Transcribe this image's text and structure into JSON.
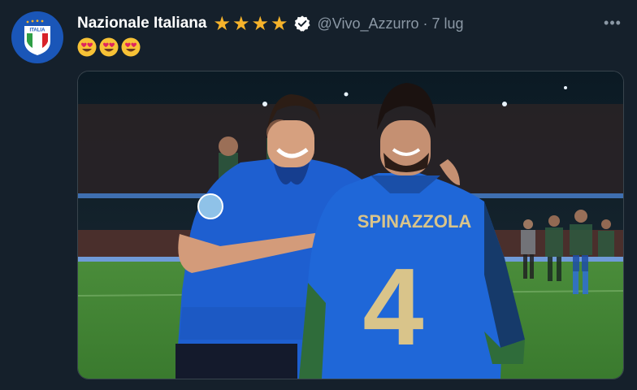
{
  "tweet": {
    "display_name": "Nazionale Italiana",
    "stars": [
      "★",
      "★",
      "★",
      "★"
    ],
    "handle": "@Vivo_Azzurro",
    "separator": "·",
    "time": "7 lug",
    "more_label": "•••",
    "text_emojis": [
      "heart-eyes-emoji",
      "heart-eyes-emoji",
      "heart-eyes-emoji"
    ]
  },
  "avatar": {
    "logo_text": "ITALIA",
    "colors": {
      "background": "#1a56b8",
      "green": "#2e9e45",
      "red": "#d8232a",
      "white": "#ffffff"
    }
  },
  "media": {
    "jersey_name": "SPINAZZOLA",
    "jersey_number": "4",
    "colors": {
      "jersey": "#1e63d6",
      "gold": "#d9c48a",
      "pitch": "#3d7d32"
    }
  },
  "theme": {
    "background": "#15202b",
    "secondary_text": "#8b98a5",
    "star_color": "#f6b32b",
    "verified_bg": "#ffffff"
  }
}
